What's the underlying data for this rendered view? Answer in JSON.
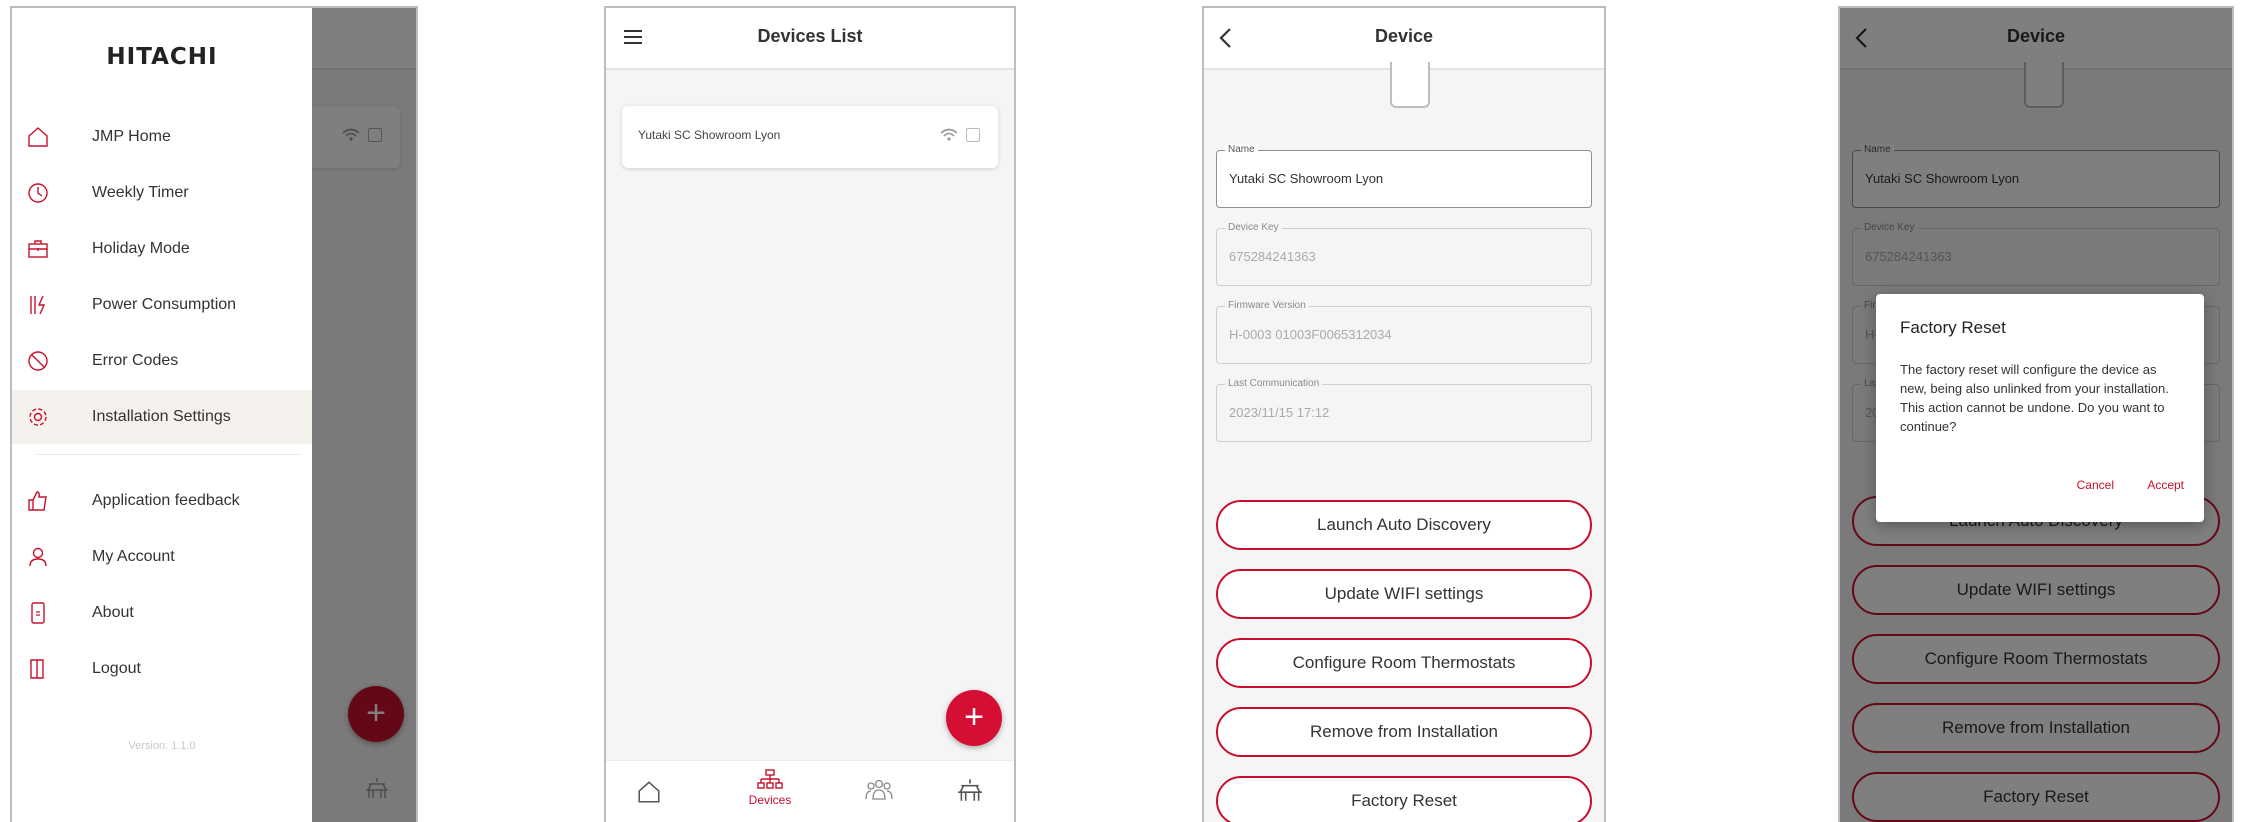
{
  "accent_color": "#c8102e",
  "screen_menu": {
    "logo": "HITACHI",
    "items": [
      {
        "label": "JMP Home",
        "icon": "home-icon"
      },
      {
        "label": "Weekly Timer",
        "icon": "clock-icon"
      },
      {
        "label": "Holiday Mode",
        "icon": "suitcase-icon"
      },
      {
        "label": "Power Consumption",
        "icon": "power-consumption-icon"
      },
      {
        "label": "Error Codes",
        "icon": "prohibited-icon"
      },
      {
        "label": "Installation Settings",
        "icon": "gear-icon"
      },
      {
        "label": "Application feedback",
        "icon": "thumbs-up-icon"
      },
      {
        "label": "My Account",
        "icon": "user-icon"
      },
      {
        "label": "About",
        "icon": "info-device-icon"
      },
      {
        "label": "Logout",
        "icon": "door-icon"
      }
    ],
    "version": "Version: 1.1.0",
    "fab_label": "+"
  },
  "screen_devices": {
    "title": "Devices List",
    "device_name": "Yutaki SC Showroom Lyon",
    "fab_label": "+",
    "nav_devices_label": "Devices"
  },
  "screen_device": {
    "title": "Device",
    "fields": {
      "name_label": "Name",
      "name_value": "Yutaki SC Showroom Lyon",
      "key_label": "Device Key",
      "key_value": "675284241363",
      "fw_label": "Firmware Version",
      "fw_value": "H-0003 01003F0065312034",
      "last_label": "Last Communication",
      "last_value": "2023/11/15 17:12"
    },
    "buttons": {
      "discovery": "Launch Auto Discovery",
      "wifi": "Update WIFI settings",
      "thermostats": "Configure Room Thermostats",
      "remove": "Remove from Installation",
      "reset": "Factory Reset"
    }
  },
  "screen_dialog": {
    "dialog_title": "Factory Reset",
    "dialog_body": "The factory reset will configure the device as new, being also unlinked from your installation. This action cannot be undone. Do you want to continue?",
    "cancel": "Cancel",
    "accept": "Accept"
  }
}
